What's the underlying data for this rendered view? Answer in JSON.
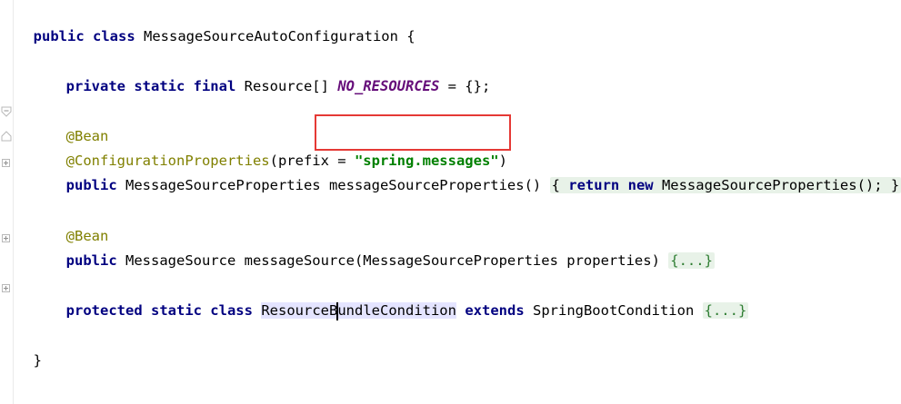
{
  "code": {
    "l1": {
      "kw": "public class",
      "name": "MessageSourceAutoConfiguration",
      "brace": " {"
    },
    "l2": {
      "kw": "private static final",
      "type": "Resource[]",
      "const": "NO_RESOURCES",
      "rest": " = {};"
    },
    "l3": {
      "ann": "@Bean"
    },
    "l4": {
      "ann": "@ConfigurationProperties",
      "open": "(prefix = ",
      "str": "\"spring.messages\"",
      "close": ")"
    },
    "l5": {
      "kw": "public",
      "sig": " MessageSourceProperties messageSourceProperties() ",
      "fold_kw1": "return",
      "fold_kw2": "new",
      "fold_body": " MessageSourceProperties(); ",
      "fold_open": "{ ",
      "fold_close": "}"
    },
    "l6": {
      "ann": "@Bean"
    },
    "l7": {
      "kw": "public",
      "sig": " MessageSource messageSource(MessageSourceProperties properties) ",
      "fold": "{...}"
    },
    "l8": {
      "kw": "protected static class",
      "cls_a": "ResourceB",
      "cls_b": "undleCondition",
      "kw2": "extends",
      "parent": " SpringBootCondition ",
      "fold": "{...}"
    },
    "l9": {
      "brace": "}"
    }
  },
  "colors": {
    "keyword": "#000080",
    "annotation": "#808000",
    "string": "#008000",
    "constant": "#660e7a",
    "highlight_box": "#e53935"
  }
}
